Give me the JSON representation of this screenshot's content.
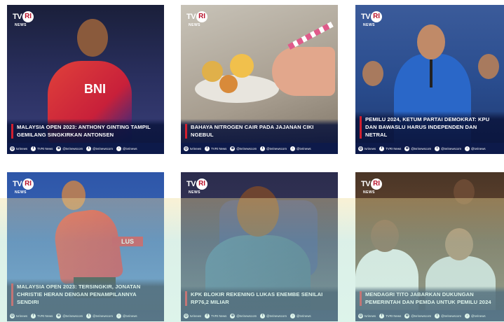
{
  "brand": {
    "logo_main": "TV",
    "logo_circle": "RI",
    "logo_sub": "NEWS"
  },
  "footer": {
    "handle_1": "tvrinews",
    "handle_2": "TVRI News",
    "handle_3": "@tvrinewscom",
    "handle_4": "@tvrinews"
  },
  "posts": [
    {
      "title": "MALAYSIA OPEN 2023: ANTHONY GINTING TAMPIL GEMILANG SINGKIRKAN ANTONSEN"
    },
    {
      "title": "BAHAYA NITROGEN CAIR PADA JAJANAN CIKI NGEBUL"
    },
    {
      "title": "PEMILU 2024, KETUM PARTAI DEMOKRAT: KPU DAN BAWASLU HARUS INDEPENDEN DAN NETRAL"
    },
    {
      "title": "MALAYSIA OPEN 2023: TERSINGKIR, JONATAN CHRISTIE HERAN DENGAN PENAMPILANNYA SENDIRI"
    },
    {
      "title": "KPK BLOKIR REKENING LUKAS ENEMBE SENILAI RP76,2 MILIAR"
    },
    {
      "title": "MENDAGRI TITO JABARKAN DUKUNGAN PEMERINTAH DAN PEMDA UNTUK PEMILU 2024"
    }
  ],
  "colors": {
    "accent_red": "#d11f2f",
    "footer_navy": "#0d1a4a"
  },
  "icons": {
    "footer": [
      "instagram-icon",
      "facebook-icon",
      "globe-icon",
      "twitter-icon",
      "tiktok-icon"
    ]
  }
}
